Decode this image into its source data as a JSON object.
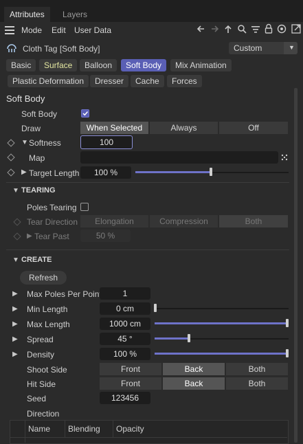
{
  "tabs": {
    "attributes": "Attributes",
    "layers": "Layers"
  },
  "menu": {
    "mode": "Mode",
    "edit": "Edit",
    "user_data": "User Data"
  },
  "object": {
    "title": "Cloth Tag [Soft Body]",
    "preset": "Custom"
  },
  "ptabs": [
    "Basic",
    "Surface",
    "Balloon",
    "Soft Body",
    "Mix Animation",
    "Plastic Deformation",
    "Dresser",
    "Cache",
    "Forces"
  ],
  "softbody": {
    "heading": "Soft Body",
    "soft_body_label": "Soft Body",
    "draw_label": "Draw",
    "draw_options": [
      "When Selected",
      "Always",
      "Off"
    ],
    "softness_label": "Softness",
    "softness_value": "100",
    "map_label": "Map",
    "target_length_label": "Target Length",
    "target_length_value": "100 %",
    "target_length_level": 0.49
  },
  "tearing": {
    "title": "TEARING",
    "poles_tearing_label": "Poles Tearing",
    "tear_direction_label": "Tear Direction",
    "tear_direction_options": [
      "Elongation",
      "Compression",
      "Both"
    ],
    "tear_past_label": "Tear Past",
    "tear_past_value": "50 %"
  },
  "create": {
    "title": "CREATE",
    "refresh": "Refresh",
    "max_poles_label": "Max Poles Per Point",
    "max_poles_value": "1",
    "min_length_label": "Min Length",
    "min_length_value": "0 cm",
    "min_length_level": 0.0,
    "max_length_label": "Max Length",
    "max_length_value": "1000 cm",
    "max_length_level": 1.0,
    "spread_label": "Spread",
    "spread_value": "45 °",
    "spread_level": 0.25,
    "density_label": "Density",
    "density_value": "100 %",
    "density_level": 1.0,
    "shoot_side_label": "Shoot Side",
    "hit_side_label": "Hit Side",
    "side_options": [
      "Front",
      "Back",
      "Both"
    ],
    "seed_label": "Seed",
    "seed_value": "123456",
    "direction_label": "Direction",
    "table_columns": [
      "Name",
      "Blending",
      "Opacity"
    ]
  },
  "colors": {
    "accent": "#5a5fb5",
    "slider": "#6e72c9",
    "highlight_tab_text": "#e3e6a0"
  }
}
